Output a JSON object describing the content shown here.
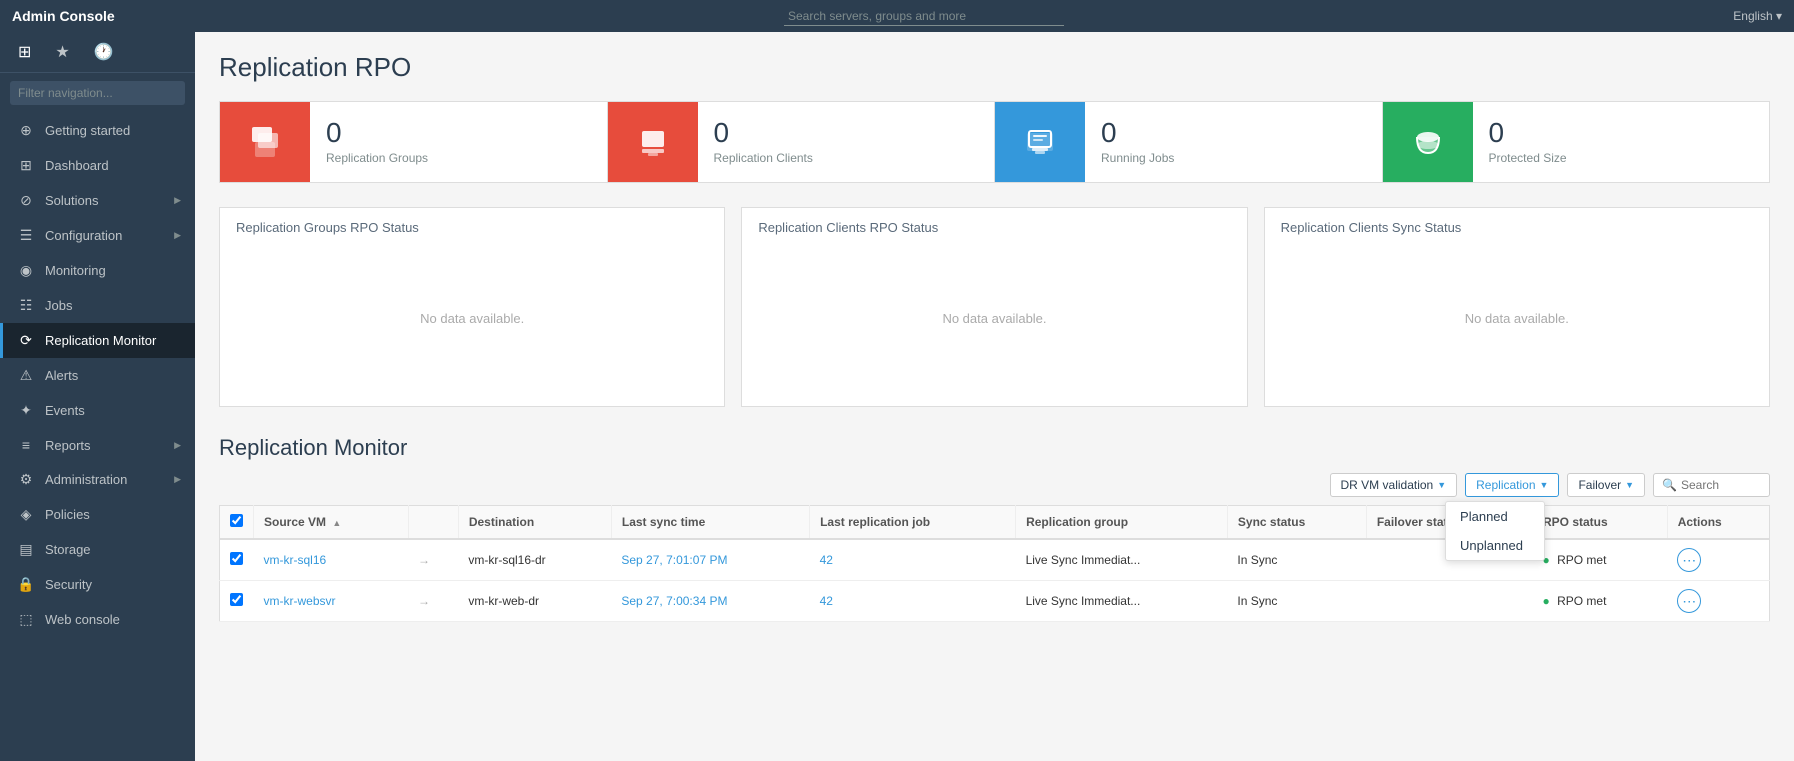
{
  "topbar": {
    "title": "Admin Console",
    "search_placeholder": "Search servers, groups and more",
    "language": "English ▾"
  },
  "sidebar": {
    "filter_placeholder": "Filter navigation...",
    "items": [
      {
        "id": "getting-started",
        "label": "Getting started",
        "icon": "⊕",
        "active": false
      },
      {
        "id": "dashboard",
        "label": "Dashboard",
        "icon": "⊞",
        "active": false
      },
      {
        "id": "solutions",
        "label": "Solutions",
        "icon": "⊘",
        "active": false,
        "arrow": true
      },
      {
        "id": "configuration",
        "label": "Configuration",
        "icon": "☰",
        "active": false,
        "arrow": true
      },
      {
        "id": "monitoring",
        "label": "Monitoring",
        "icon": "◉",
        "active": false
      },
      {
        "id": "jobs",
        "label": "Jobs",
        "icon": "☷",
        "active": false
      },
      {
        "id": "replication-monitor",
        "label": "Replication Monitor",
        "icon": "⟳",
        "active": true
      },
      {
        "id": "alerts",
        "label": "Alerts",
        "icon": "⚠",
        "active": false
      },
      {
        "id": "events",
        "label": "Events",
        "icon": "✦",
        "active": false
      },
      {
        "id": "reports",
        "label": "Reports",
        "icon": "≡",
        "active": false,
        "arrow": true
      },
      {
        "id": "administration",
        "label": "Administration",
        "icon": "⚙",
        "active": false,
        "arrow": true
      },
      {
        "id": "policies",
        "label": "Policies",
        "icon": "◈",
        "active": false
      },
      {
        "id": "storage",
        "label": "Storage",
        "icon": "▤",
        "active": false
      },
      {
        "id": "security",
        "label": "Security",
        "icon": "🔒",
        "active": false
      },
      {
        "id": "web-console",
        "label": "Web console",
        "icon": "⬚",
        "active": false
      }
    ]
  },
  "page": {
    "title": "Replication RPO",
    "stats": [
      {
        "id": "replication-groups",
        "value": "0",
        "label": "Replication Groups",
        "color": "red",
        "icon": "copy"
      },
      {
        "id": "replication-clients",
        "value": "0",
        "label": "Replication Clients",
        "color": "red",
        "icon": "client"
      },
      {
        "id": "running-jobs",
        "value": "0",
        "label": "Running Jobs",
        "color": "blue",
        "icon": "jobs"
      },
      {
        "id": "protected-size",
        "value": "0",
        "label": "Protected Size",
        "color": "green",
        "icon": "db"
      }
    ],
    "status_panels": [
      {
        "id": "groups-rpo",
        "title": "Replication Groups RPO Status",
        "no_data": "No data available."
      },
      {
        "id": "clients-rpo",
        "title": "Replication Clients RPO Status",
        "no_data": "No data available."
      },
      {
        "id": "clients-sync",
        "title": "Replication Clients Sync Status",
        "no_data": "No data available."
      }
    ],
    "monitor": {
      "title": "Replication Monitor",
      "filters": {
        "dr_vm": "DR VM validation",
        "replication": "Replication",
        "failover": "Failover",
        "search_placeholder": "Search"
      },
      "failover_dropdown": [
        {
          "id": "planned",
          "label": "Planned"
        },
        {
          "id": "unplanned",
          "label": "Unplanned"
        }
      ],
      "table": {
        "columns": [
          {
            "id": "checkbox",
            "label": ""
          },
          {
            "id": "source-vm",
            "label": "Source VM",
            "sort": "asc"
          },
          {
            "id": "arrow",
            "label": ""
          },
          {
            "id": "destination",
            "label": "Destination"
          },
          {
            "id": "last-sync",
            "label": "Last sync time"
          },
          {
            "id": "last-job",
            "label": "Last replication job"
          },
          {
            "id": "rep-group",
            "label": "Replication group"
          },
          {
            "id": "sync-status",
            "label": "Sync status"
          },
          {
            "id": "failover-status",
            "label": "Failover status"
          },
          {
            "id": "rpo-status",
            "label": "RPO status"
          },
          {
            "id": "actions",
            "label": "Actions"
          }
        ],
        "rows": [
          {
            "checkbox": true,
            "source_vm": "vm-kr-sql16",
            "arrow": "→",
            "destination": "vm-kr-sql16-dr",
            "last_sync": "Sep 27, 7:01:07 PM",
            "last_job": "42",
            "rep_group": "Live Sync Immediat...",
            "sync_status": "In Sync",
            "failover_status": "",
            "rpo_status": "RPO met",
            "rpo_dot": true
          },
          {
            "checkbox": true,
            "source_vm": "vm-kr-websvr",
            "arrow": "→",
            "destination": "vm-kr-web-dr",
            "last_sync": "Sep 27, 7:00:34 PM",
            "last_job": "42",
            "rep_group": "Live Sync Immediat...",
            "sync_status": "In Sync",
            "failover_status": "",
            "rpo_status": "RPO met",
            "rpo_dot": true
          }
        ]
      }
    }
  }
}
